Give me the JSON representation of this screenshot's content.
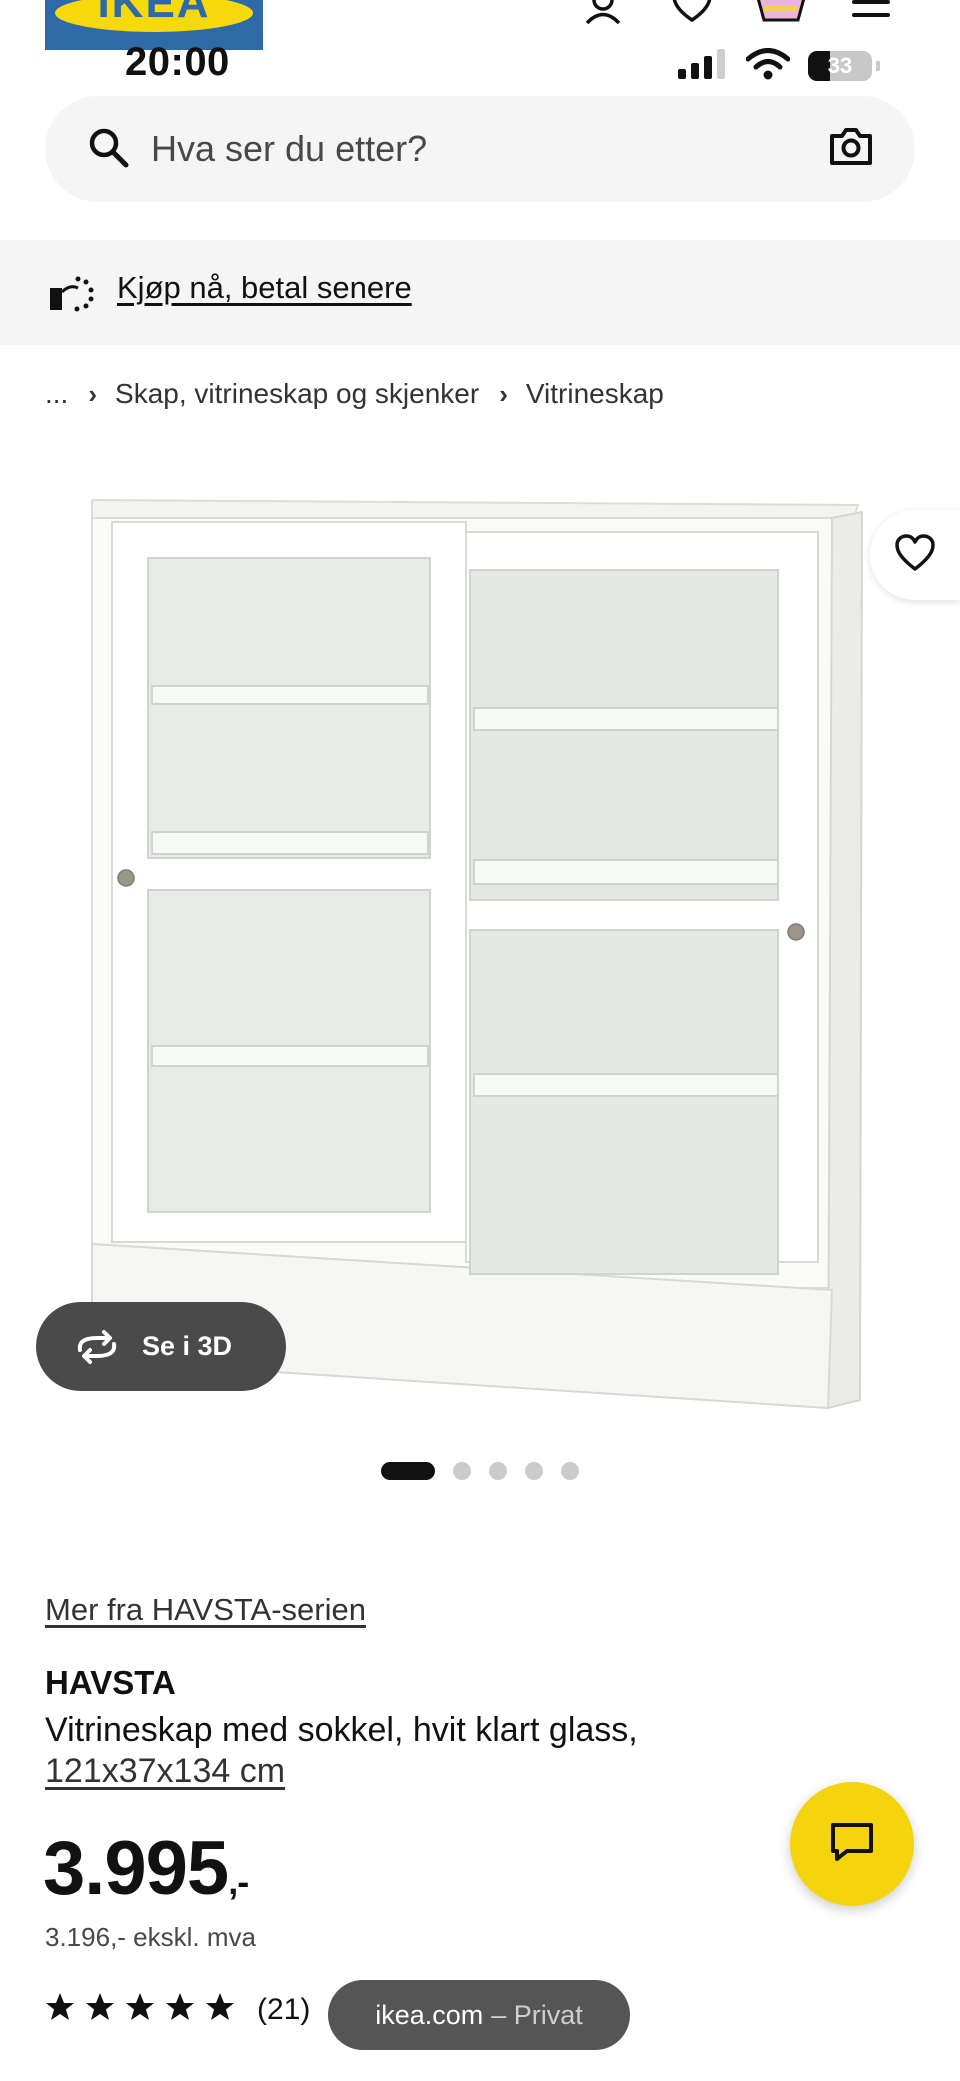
{
  "header": {
    "logo_text": "IKEA",
    "time": "20:00",
    "battery": "33",
    "icons": [
      "user-icon",
      "heart-icon",
      "basket-icon",
      "menu-icon"
    ]
  },
  "search": {
    "placeholder": "Hva ser du etter?",
    "icon": "search-icon",
    "camera_icon": "camera-icon"
  },
  "promo": {
    "label": "Kjøp nå, betal senere",
    "icon": "pay-later-icon"
  },
  "breadcrumb": {
    "ellipsis": "...",
    "items": [
      "Skap, vitrineskap og skjenker",
      "Vitrineskap"
    ]
  },
  "gallery": {
    "view_3d_label": "Se i 3D",
    "image_count": 5,
    "active_index": 0
  },
  "product": {
    "series_link": "Mer fra HAVSTA-serien",
    "name": "HAVSTA",
    "description": "Vitrineskap med sokkel, hvit klart glass,",
    "size": "121x37x134 cm",
    "price": "3.995",
    "price_suffix": ",-",
    "price_ex_vat": "3.196,- ekskl. mva",
    "rating_stars": 5,
    "rating_count": "(21)"
  },
  "browser": {
    "host": "ikea.com",
    "mode": "– Privat"
  },
  "colors": {
    "accent_yellow": "#f5d40e",
    "brand_blue": "#2e6aa8",
    "dark_pill": "#4a4a4a"
  }
}
